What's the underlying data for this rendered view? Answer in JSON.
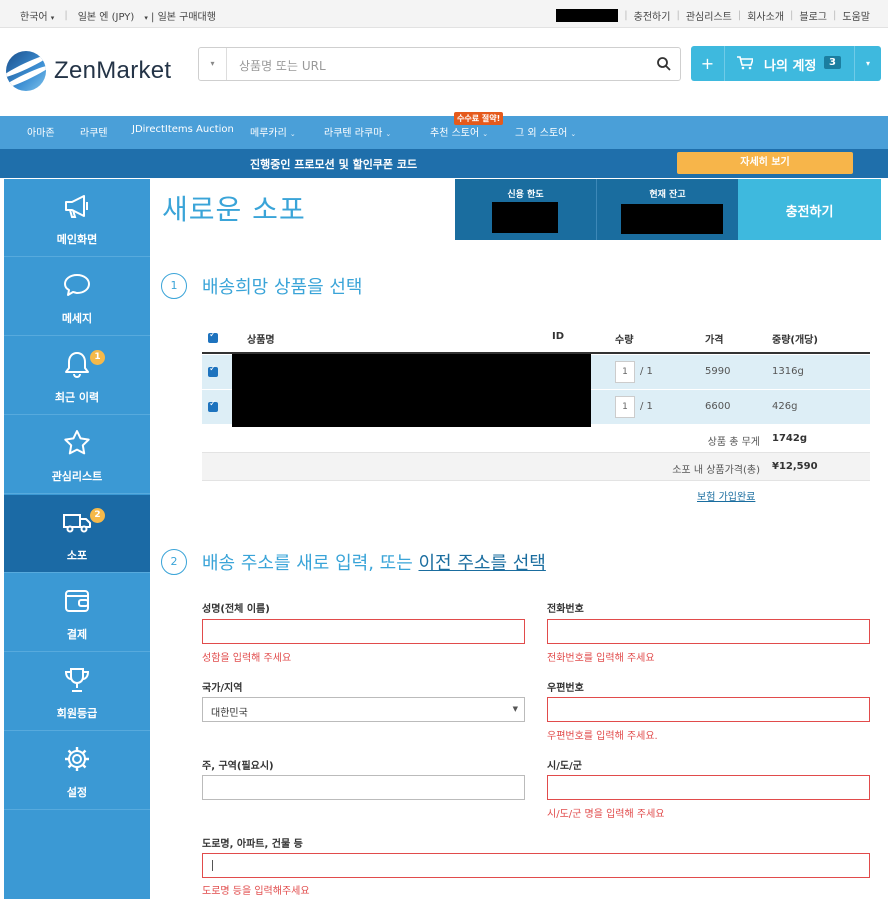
{
  "topbar": {
    "language": "한국어",
    "currency": "일본 엔 (JPY)",
    "service": "일본 구매대행",
    "links": [
      "충전하기",
      "관심리스트",
      "회사소개",
      "블로그",
      "도움말"
    ]
  },
  "header": {
    "logo": "ZenMarket",
    "search_placeholder": "상품명 또는 URL",
    "account_label": "나의 계정",
    "account_badge": "3",
    "plus": "+"
  },
  "nav": {
    "items": [
      "아마존",
      "라쿠텐",
      "JDirectItems Auction",
      "메루카리",
      "라쿠텐 라쿠마",
      "추천 스토어",
      "그 외 스토어"
    ],
    "hot_badge": "수수료 절약!"
  },
  "promo": {
    "text": "진행중인 프로모션 및 할인쿠폰 코드",
    "button": "자세히 보기"
  },
  "sidebar": {
    "items": [
      {
        "label": "메인화면",
        "icon": "megaphone-icon"
      },
      {
        "label": "메세지",
        "icon": "chat-bubble-icon"
      },
      {
        "label": "최근 이력",
        "icon": "bell-icon",
        "badge": "1"
      },
      {
        "label": "관심리스트",
        "icon": "star-icon"
      },
      {
        "label": "소포",
        "icon": "truck-icon",
        "badge": "2"
      },
      {
        "label": "결제",
        "icon": "wallet-icon"
      },
      {
        "label": "회원등급",
        "icon": "trophy-icon"
      },
      {
        "label": "설정",
        "icon": "gear-icon"
      }
    ]
  },
  "main": {
    "title": "새로운 소포",
    "balance": {
      "credit_label": "신용 한도",
      "current_label": "현재 잔고",
      "topup": "충전하기"
    },
    "step1": {
      "num": "1",
      "title": "배송희망 상품을 선택"
    },
    "table": {
      "headers": {
        "name": "상품명",
        "id": "ID",
        "qty": "수량",
        "price": "가격",
        "weight": "중량(개당)"
      },
      "rows": [
        {
          "qty": "1",
          "qty_total": "/ 1",
          "price": "5990",
          "weight": "1316g"
        },
        {
          "qty": "1",
          "qty_total": "/ 1",
          "price": "6600",
          "weight": "426g"
        }
      ],
      "total_weight_label": "상품 총 무게",
      "total_weight": "1742g",
      "total_price_label": "소포 내 상품가격(총)",
      "total_price": "¥12,590",
      "insurance": "보험 가입완료"
    },
    "step2": {
      "num": "2",
      "title_prefix": "배송 주소를 새로 입력, 또는 ",
      "title_link": "이전 주소를 선택"
    },
    "form": {
      "name_label": "성명(전체 이름)",
      "name_error": "성함을 입력해 주세요",
      "phone_label": "전화번호",
      "phone_error": "전화번호를 입력해 주세요",
      "country_label": "국가/지역",
      "country_value": "대한민국",
      "zip_label": "우편번호",
      "zip_error": "우편번호를 입력해 주세요.",
      "state_label": "주, 구역(필요시)",
      "city_label": "시/도/군",
      "city_error": "시/도/군 명을 입력해 주세요",
      "street_label": "도로명, 아파트, 건물 등",
      "street_error": "도로명 등을 입력해주세요"
    }
  },
  "colors": {
    "accent": "#3aa4d8",
    "dark_blue": "#1a6d9f",
    "sidebar": "#3b99d4",
    "error": "#e14b4b",
    "promo_button": "#f7b54a"
  }
}
